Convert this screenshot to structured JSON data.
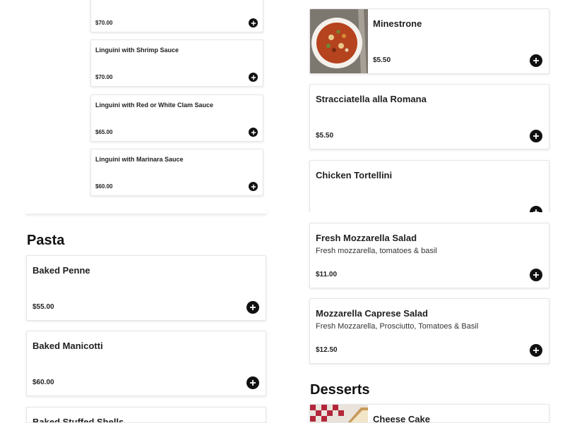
{
  "left_column": {
    "partial_items": [
      {
        "name": "",
        "price": "$70.00"
      },
      {
        "name": "Linguini with Shrimp Sauce",
        "price": "$70.00"
      },
      {
        "name": "Linguini with Red or White Clam Sauce",
        "price": "$65.00"
      },
      {
        "name": "Linguini with Marinara Sauce",
        "price": "$60.00"
      }
    ],
    "pasta": {
      "title": "Pasta",
      "items": [
        {
          "name": "Baked Penne",
          "price": "$55.00"
        },
        {
          "name": "Baked Manicotti",
          "price": "$60.00"
        },
        {
          "name": "Baked Stuffed Shells",
          "price": ""
        }
      ]
    }
  },
  "right_column": {
    "soups": [
      {
        "name": "Minestrone",
        "price": "$5.50",
        "icon": "minestrone-photo"
      },
      {
        "name": "Stracciatella alla Romana",
        "price": "$5.50"
      },
      {
        "name": "Chicken Tortellini",
        "price": ""
      }
    ],
    "salads": [
      {
        "name": "Fresh Mozzarella Salad",
        "description": "Fresh mozzarella, tomatoes & basil",
        "price": "$11.00"
      },
      {
        "name": "Mozzarella Caprese Salad",
        "description": "Fresh Mozzarella, Prosciutto, Tomatoes & Basil",
        "price": "$12.50"
      }
    ],
    "desserts": {
      "title": "Desserts",
      "items": [
        {
          "name": "Cheese Cake",
          "icon": "cheesecake-photo"
        }
      ]
    }
  },
  "icons": {
    "add": "plus-circle-icon"
  },
  "colors": {
    "button": "#111111",
    "card_border": "#e6e6e6"
  }
}
